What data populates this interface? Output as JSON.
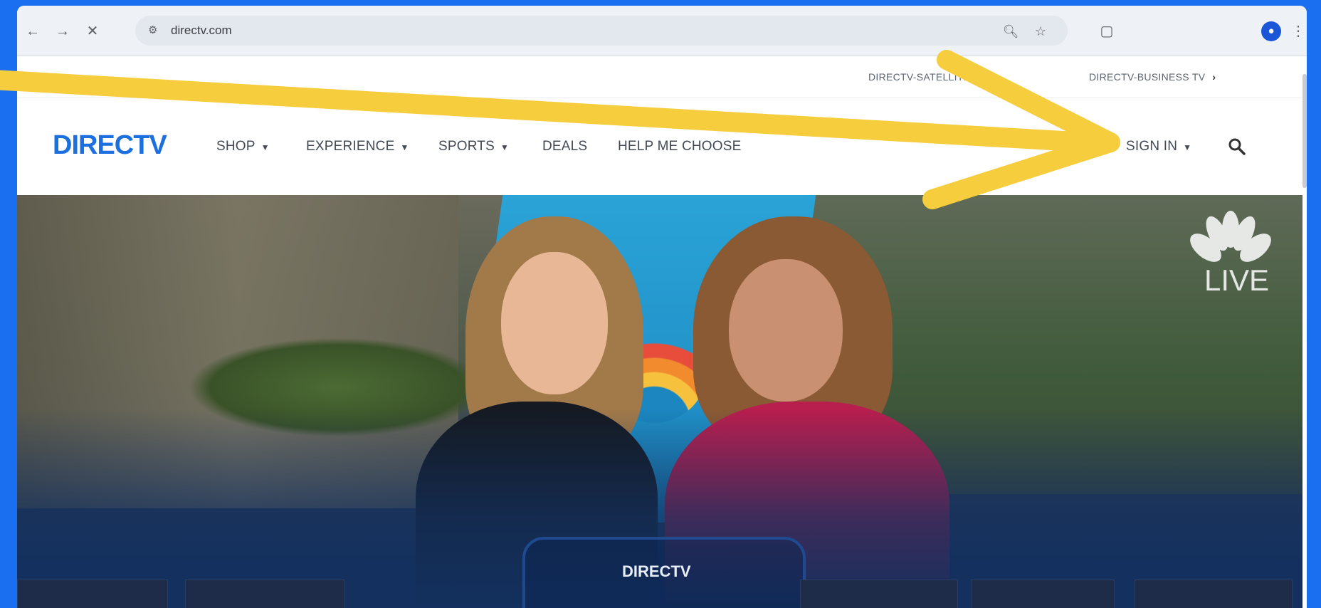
{
  "browser": {
    "url": "directv.com",
    "icons": [
      "back-icon",
      "forward-icon",
      "close-icon",
      "site-info-icon",
      "zoom-icon",
      "bookmark-star-icon",
      "extensions-icon",
      "profile-icon",
      "more-icon"
    ]
  },
  "utility_bar": {
    "links": [
      {
        "label": "DIRECTV-SATELLITE TV"
      },
      {
        "label": "DIRECTV-BUSINESS TV"
      }
    ]
  },
  "header": {
    "logo": "DIRECTV",
    "nav": [
      {
        "label": "SHOP"
      },
      {
        "label": "EXPERIENCE"
      },
      {
        "label": "SPORTS"
      },
      {
        "label": "DEALS"
      },
      {
        "label": "HELP ME CHOOSE"
      }
    ],
    "sign_in": "SIGN IN"
  },
  "hero": {
    "badge": "LIVE",
    "brand": "DIRECTV"
  },
  "colors": {
    "background": "#1a6ff0",
    "logo": "#1b6fde",
    "arrow": "#f6cd3d",
    "hero_bottom": "#13305e"
  }
}
